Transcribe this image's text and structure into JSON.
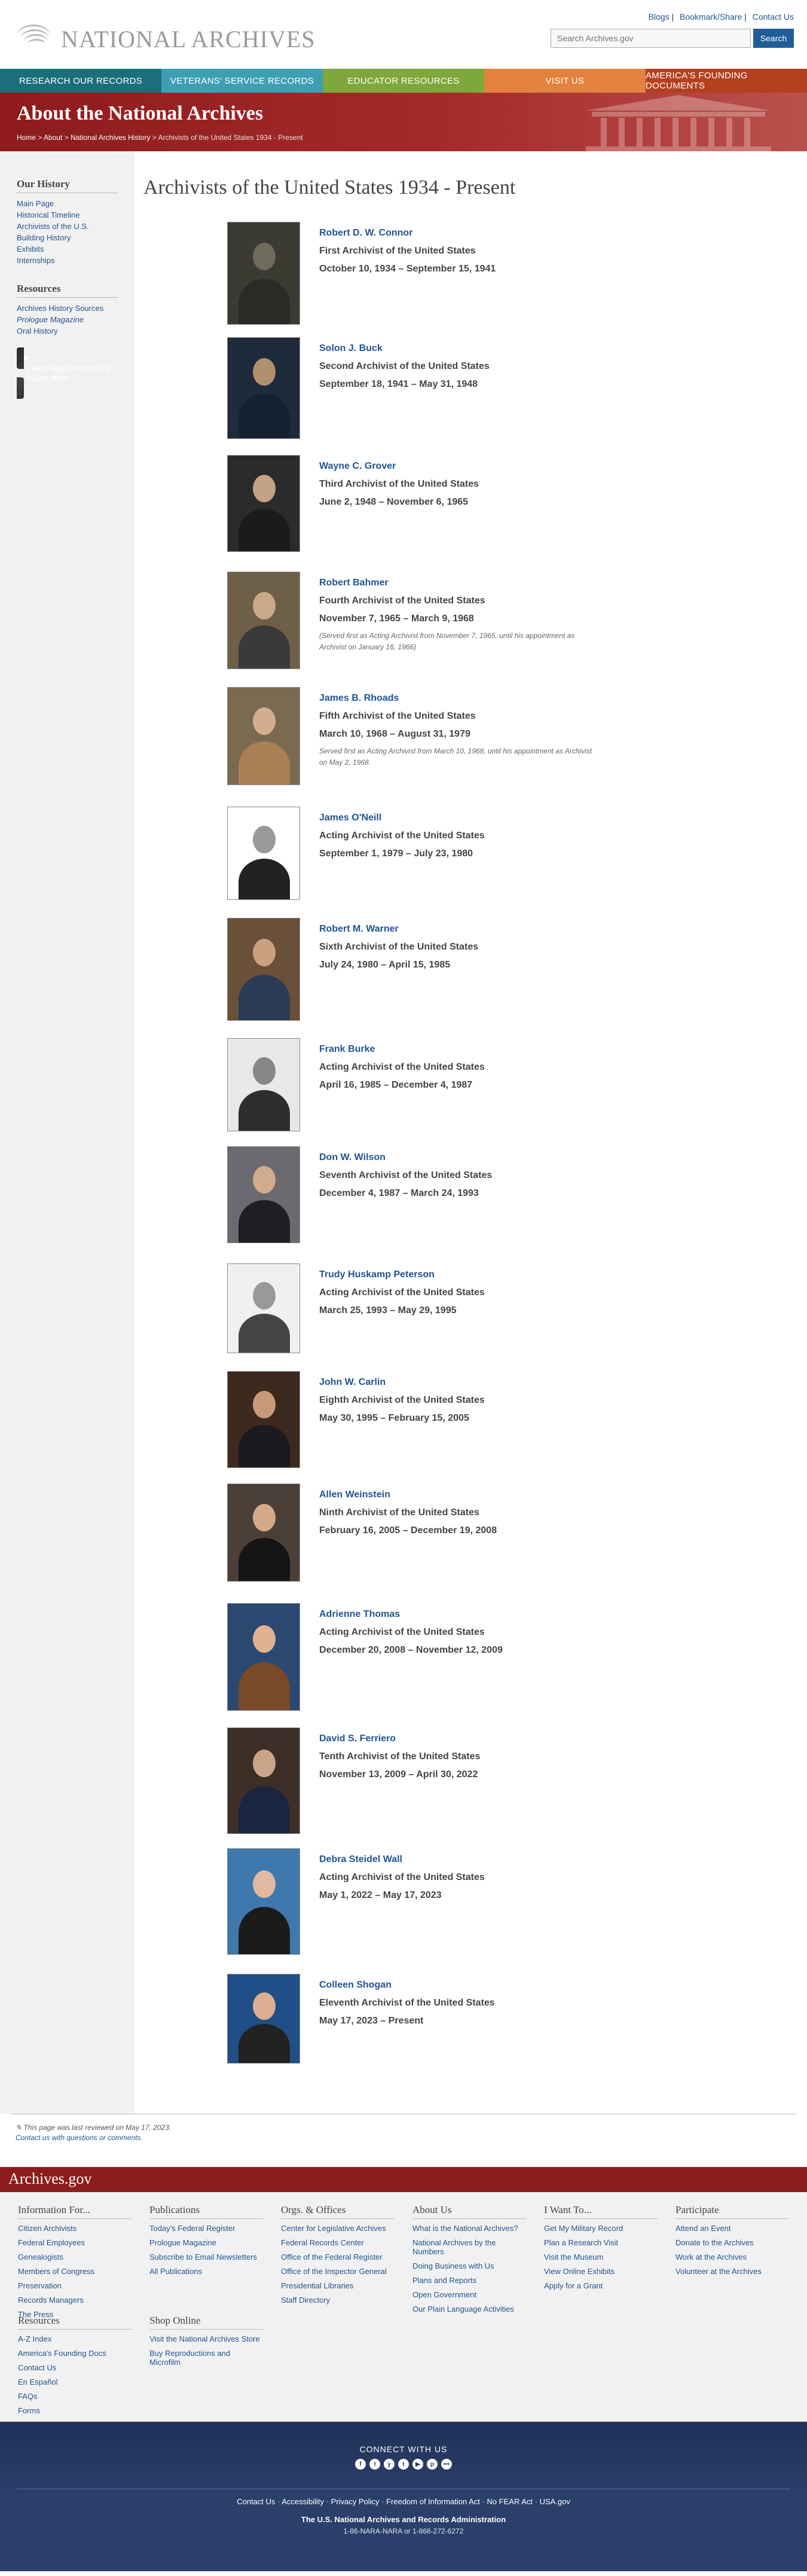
{
  "header": {
    "logo_text": "NATIONAL ARCHIVES",
    "util_links": [
      "Blogs",
      "Bookmark/Share",
      "Contact Us"
    ],
    "search_placeholder": "Search Archives.gov",
    "search_button": "Search"
  },
  "nav": [
    {
      "label": "Research Our Records",
      "color": "#1c6e7a"
    },
    {
      "label": "Veterans' Service Records",
      "color": "#3e9fb4"
    },
    {
      "label": "Educator Resources",
      "color": "#7ea83b"
    },
    {
      "label": "Visit Us",
      "color": "#e3823e"
    },
    {
      "label": "America's Founding Documents",
      "color": "#b5401f"
    }
  ],
  "banner": {
    "title": "About the National Archives",
    "breadcrumb": [
      "Home",
      "About",
      "National Archives History",
      "Archivists of the United States 1934 - Present"
    ]
  },
  "sidebar": {
    "history_heading": "Our History",
    "history_links": [
      "Main Page",
      "Historical Timeline",
      "Archivists of the U.S.",
      "Building History",
      "Exhibits",
      "Internships"
    ],
    "resources_heading": "Resources",
    "resources_links": [
      "Archives History Sources",
      "Prologue Magazine",
      "Oral History"
    ],
    "promo_text": "Learn why Democracy Starts Here"
  },
  "page_title": "Archivists of the United States 1934 - Present",
  "archivists": [
    {
      "name": "Robert D. W. Connor",
      "title": "First Archivist of the United States",
      "dates": "October 10, 1934 – September 15, 1941",
      "note": ""
    },
    {
      "name": "Solon J. Buck",
      "title": "Second Archivist of the United States",
      "dates": "September 18, 1941 – May 31, 1948",
      "note": ""
    },
    {
      "name": "Wayne C. Grover",
      "title": "Third Archivist of the United States",
      "dates": "June 2, 1948 – November 6, 1965",
      "note": ""
    },
    {
      "name": "Robert Bahmer",
      "title": "Fourth Archivist of the United States",
      "dates": "November 7, 1965 – March 9, 1968",
      "note": "(Served first as Acting Archivist from November 7, 1965, until his appointment as Archivist on January 16, 1966)"
    },
    {
      "name": "James B. Rhoads",
      "title": "Fifth Archivist of the United States",
      "dates": "March 10, 1968 – August 31, 1979",
      "note": "Served first as Acting Archivist from March 10, 1968, until his appointment as Archivist on May 2, 1968."
    },
    {
      "name": "James O'Neill",
      "title": "Acting Archivist of the United States",
      "dates": "September 1, 1979 – July 23, 1980",
      "note": ""
    },
    {
      "name": "Robert M. Warner",
      "title": "Sixth Archivist of the United States",
      "dates": "July 24, 1980 – April 15, 1985",
      "note": ""
    },
    {
      "name": "Frank Burke",
      "title": "Acting Archivist of the United States",
      "dates": "April 16, 1985 – December 4, 1987",
      "note": ""
    },
    {
      "name": "Don W. Wilson",
      "title": "Seventh Archivist of the United States",
      "dates": "December 4, 1987 – March 24, 1993",
      "note": ""
    },
    {
      "name": "Trudy Huskamp Peterson",
      "title": "Acting Archivist of the United States",
      "dates": "March 25, 1993 – May 29, 1995",
      "note": ""
    },
    {
      "name": "John W. Carlin",
      "title": "Eighth Archivist of the United States",
      "dates": "May 30, 1995 – February 15, 2005",
      "note": ""
    },
    {
      "name": "Allen Weinstein",
      "title": "Ninth Archivist of the United States",
      "dates": "February 16, 2005 – December 19, 2008",
      "note": ""
    },
    {
      "name": "Adrienne Thomas",
      "title": "Acting Archivist of the United States",
      "dates": "December 20, 2008 – November 12, 2009",
      "note": ""
    },
    {
      "name": "David S. Ferriero",
      "title": "Tenth Archivist of the United States",
      "dates": "November 13, 2009 – April 30, 2022",
      "note": ""
    },
    {
      "name": "Debra Steidel Wall",
      "title": "Acting Archivist of the United States",
      "dates": "May 1, 2022 – May 17, 2023",
      "note": ""
    },
    {
      "name": "Colleen Shogan",
      "title": "Eleventh Archivist of the United States",
      "dates": "May 17, 2023 – Present",
      "note": ""
    }
  ],
  "review": {
    "reviewed": "This page was last reviewed on May 17, 2023.",
    "contact": "Contact us with questions or comments."
  },
  "footer": {
    "brand": "Archives.gov",
    "columns": [
      {
        "heading": "Information For...",
        "links": [
          "Citizen Archivists",
          "Federal Employees",
          "Genealogists",
          "Members of Congress",
          "Preservation",
          "Records Managers",
          "The Press"
        ]
      },
      {
        "heading": "Publications",
        "links": [
          "Today's Federal Register",
          "Prologue Magazine",
          "Subscribe to Email Newsletters",
          "All Publications"
        ]
      },
      {
        "heading": "Orgs. & Offices",
        "links": [
          "Center for Legislative Archives",
          "Federal Records Center",
          "Office of the Federal Register",
          "Office of the Inspector General",
          "Presidential Libraries",
          "Staff Directory"
        ]
      },
      {
        "heading": "About Us",
        "links": [
          "What is the National Archives?",
          "National Archives by the Numbers",
          "Doing Business with Us",
          "Plans and Reports",
          "Open Government",
          "Our Plain Language Activities"
        ]
      },
      {
        "heading": "I Want To...",
        "links": [
          "Get My Military Record",
          "Plan a Research Visit",
          "Visit the Museum",
          "View Online Exhibits",
          "Apply for a Grant"
        ]
      },
      {
        "heading": "Participate",
        "links": [
          "Attend an Event",
          "Donate to the Archives",
          "Work at the Archives",
          "Volunteer at the Archives"
        ]
      },
      {
        "heading": "Resources",
        "links": [
          "A-Z Index",
          "America's Founding Docs",
          "Contact Us",
          "En Español",
          "FAQs",
          "Forms"
        ]
      },
      {
        "heading": "Shop Online",
        "links": [
          "Visit the National Archives Store",
          "Buy Reproductions and Microfilm"
        ]
      }
    ],
    "connect": "CONNECT WITH US",
    "social": [
      "f",
      "t",
      "y",
      "t",
      "▶",
      "p",
      "•••"
    ],
    "legal": [
      "Contact Us",
      "Accessibility",
      "Privacy Policy",
      "Freedom of Information Act",
      "No FEAR Act",
      "USA.gov"
    ],
    "agency": "The U.S. National Archives and Records Administration",
    "phone": "1-86-NARA-NARA or 1-866-272-6272"
  }
}
